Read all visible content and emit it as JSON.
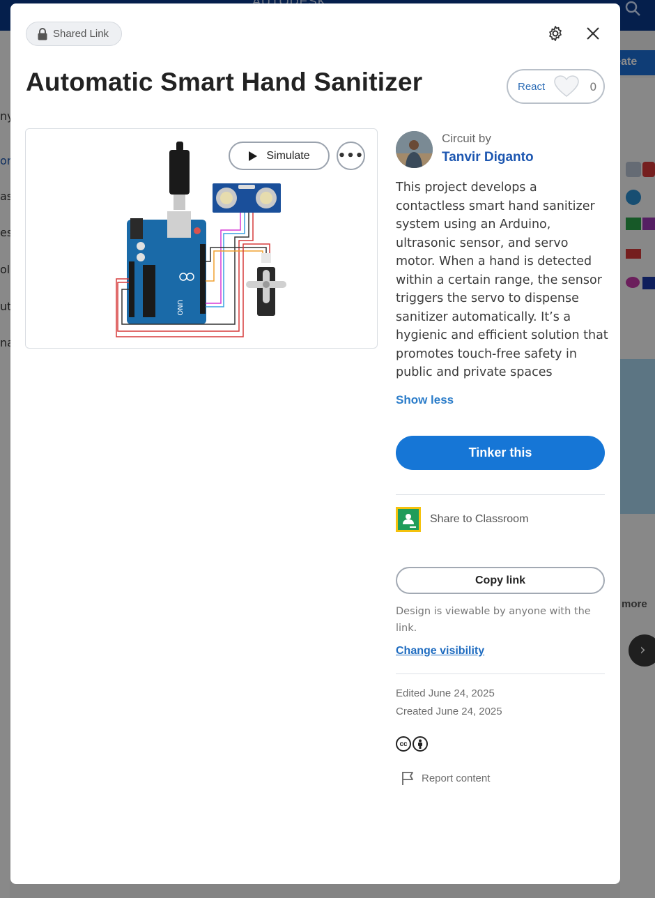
{
  "background": {
    "brand": "AUTODESK",
    "create_label": "reate",
    "left_fragments": [
      "ny",
      "on",
      "as",
      "es",
      "oll",
      "uto",
      "na"
    ],
    "more_label": "more"
  },
  "modal": {
    "shared_link_label": "Shared Link",
    "title": "Automatic Smart Hand Sanitizer",
    "react": {
      "label": "React",
      "count": "0"
    },
    "preview": {
      "simulate_label": "Simulate",
      "more_label": "•••"
    },
    "author": {
      "circuit_by_label": "Circuit by",
      "name": "Tanvir Diganto"
    },
    "description": "This project develops a contactless smart hand sanitizer system using an Arduino, ultrasonic sensor, and servo motor. When a hand is detected within a certain range, the sensor triggers the servo to dispense sanitizer automatically. It’s a hygienic and efficient solution that promotes touch-free safety in public and private spaces",
    "show_less_label": "Show less",
    "tinker_label": "Tinker this",
    "share_classroom_label": "Share to Classroom",
    "copy_link_label": "Copy link",
    "visibility_note": "Design is viewable by anyone with the link.",
    "change_visibility_label": "Change visibility",
    "edited": "Edited June 24, 2025",
    "created": "Created June 24, 2025",
    "report_label": "Report content"
  },
  "colors": {
    "accent": "#1676d6",
    "author_link": "#1c56b0",
    "arduino_blue": "#1a6aa8"
  }
}
